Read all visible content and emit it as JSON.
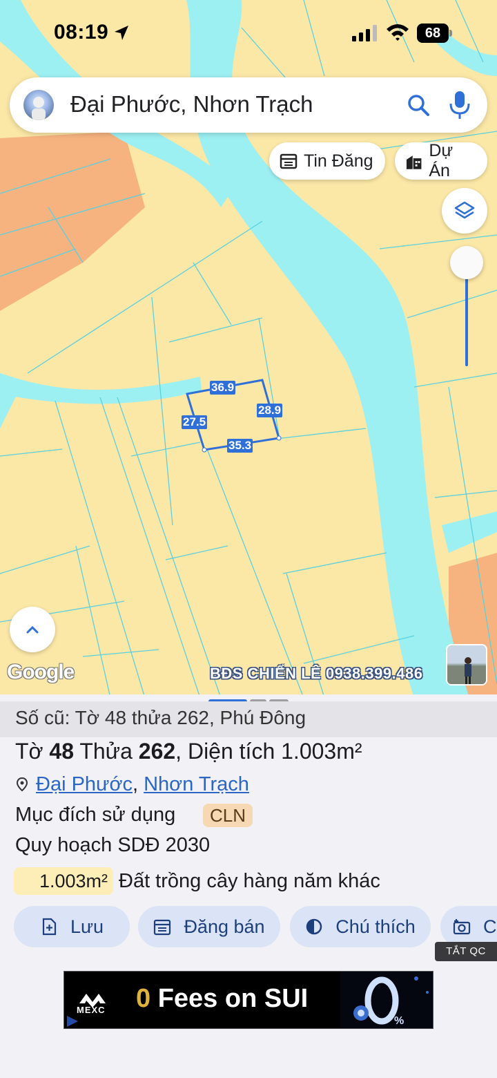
{
  "status_bar": {
    "time": "08:19",
    "battery": "68"
  },
  "search": {
    "query": "Đại Phước, Nhơn Trạch"
  },
  "chips": {
    "listing": "Tin Đăng",
    "project": "Dự Án"
  },
  "map": {
    "measurements": {
      "top": "36.9",
      "right": "28.9",
      "bottom": "35.3",
      "left": "27.5"
    },
    "attribution": "Google",
    "watermark": "BĐS CHIẾN LÊ 0938.399.486"
  },
  "parcel": {
    "old_info": "Số cũ: Tờ 48 thửa 262, Phú Đông",
    "sheet_label": "Tờ",
    "sheet_no": "48",
    "plot_label": "Thửa",
    "plot_no": "262",
    "area_label": ", Diện tích",
    "area_value": "1.003m²",
    "ward": "Đại Phước",
    "district": "Nhơn Trạch",
    "purpose_label": "Mục đích sử dụng",
    "purpose_code": "CLN",
    "plan_label": "Quy hoạch SDĐ 2030",
    "plan_area": "1.003m²",
    "plan_use": "Đất trồng cây hàng năm khác"
  },
  "actions": {
    "save": "Lưu",
    "post_sale": "Đăng bán",
    "legend": "Chú thích",
    "more": "C"
  },
  "ad": {
    "close_label": "TẮT QC",
    "brand": "MEXC",
    "headline_zero": "0",
    "headline_rest": " Fees on SUI"
  },
  "colors": {
    "land": "#fbe7a6",
    "water": "#9cf0f2",
    "orange": "#f6b37f",
    "parcel_blue": "#2f6fd8"
  },
  "icons": [
    "location-arrow-icon",
    "signal-icon",
    "wifi-icon",
    "battery-icon",
    "search-icon",
    "mic-icon",
    "calendar-list-icon",
    "building-icon",
    "layers-icon",
    "chevron-up-icon",
    "pin-icon",
    "save-icon",
    "calendar-icon",
    "contrast-icon",
    "camera-icon"
  ]
}
